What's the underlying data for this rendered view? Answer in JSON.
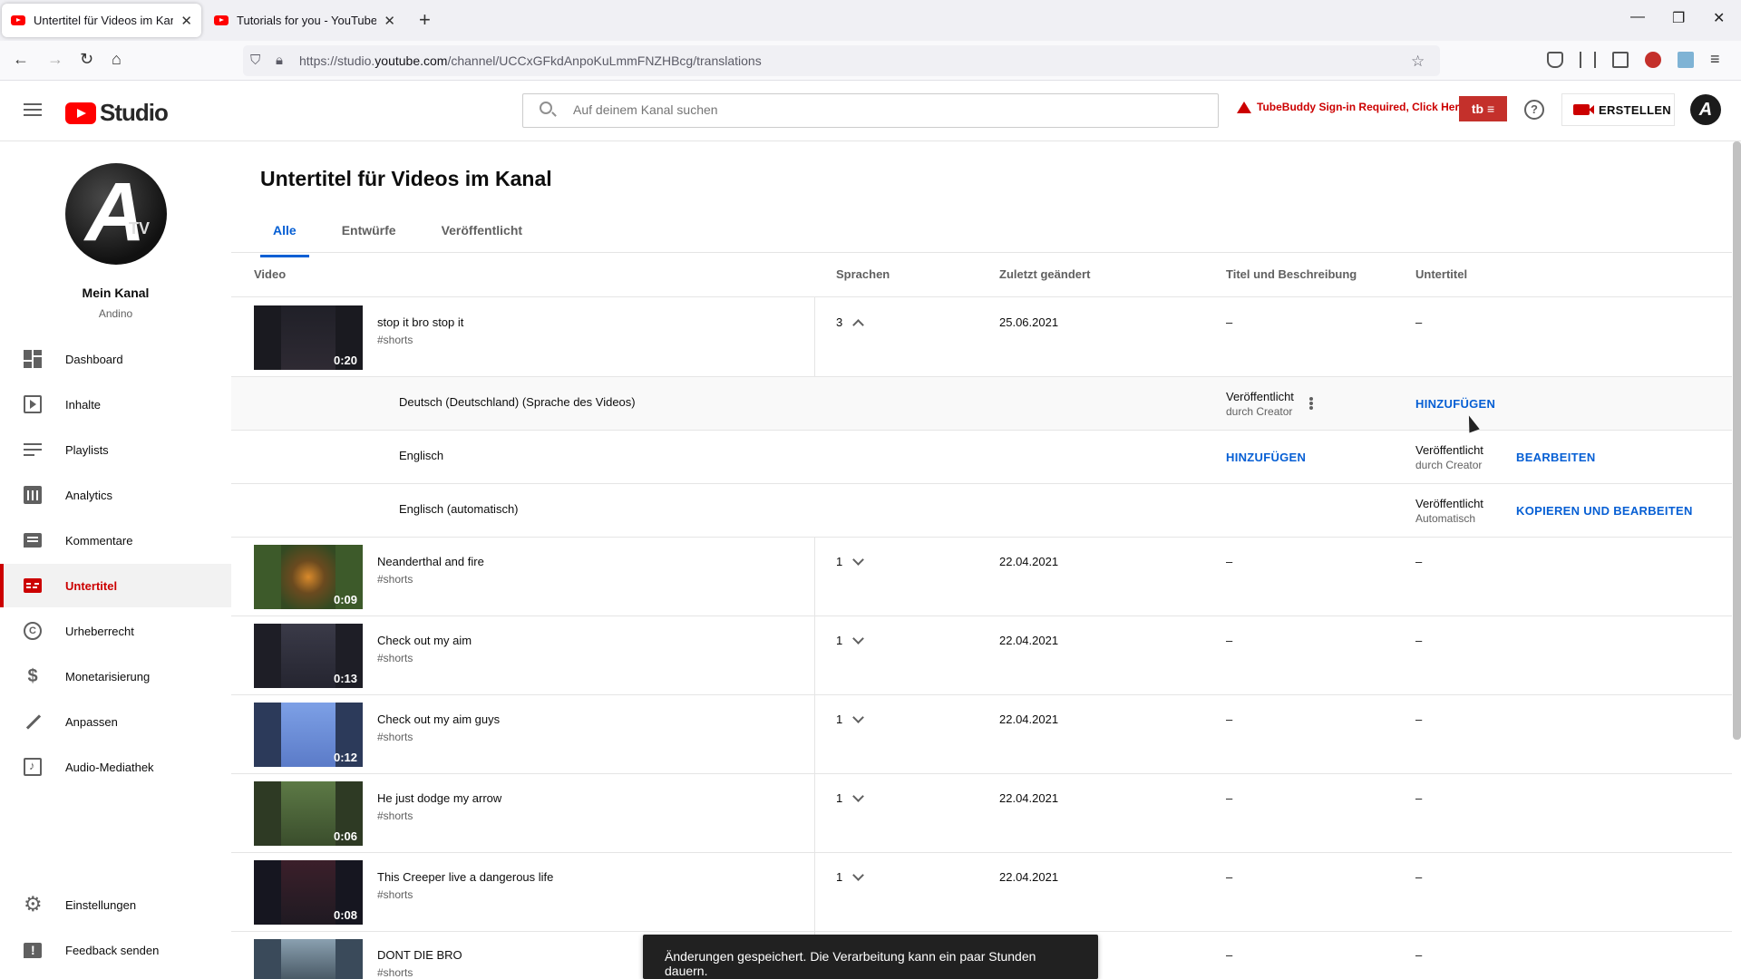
{
  "browser": {
    "tabs": [
      {
        "title": "Untertitel für Videos im Kanal -",
        "close": "✕"
      },
      {
        "title": "Tutorials for you - YouTube",
        "close": "✕"
      }
    ],
    "new_tab": "+",
    "url_prefix": "https://studio.",
    "url_domain": "youtube.com",
    "url_path": "/channel/UCCxGFkdAnpoKuLmmFNZHBcg/translations"
  },
  "header": {
    "logo_text": "Studio",
    "search_placeholder": "Auf deinem Kanal suchen",
    "tubebuddy_text": "TubeBuddy Sign-in Required, Click Here",
    "help": "?",
    "create_label": "ERSTELLEN",
    "avatar_letter": "A"
  },
  "sidebar": {
    "channel_name": "Mein Kanal",
    "channel_handle": "Andino",
    "items": [
      {
        "label": "Dashboard",
        "icon": "dashboard-icon"
      },
      {
        "label": "Inhalte",
        "icon": "content-icon"
      },
      {
        "label": "Playlists",
        "icon": "playlists-icon"
      },
      {
        "label": "Analytics",
        "icon": "analytics-icon"
      },
      {
        "label": "Kommentare",
        "icon": "comments-icon"
      },
      {
        "label": "Untertitel",
        "icon": "subtitles-icon"
      },
      {
        "label": "Urheberrecht",
        "icon": "copyright-icon"
      },
      {
        "label": "Monetarisierung",
        "icon": "monetization-icon"
      },
      {
        "label": "Anpassen",
        "icon": "customization-icon"
      },
      {
        "label": "Audio-Mediathek",
        "icon": "audio-library-icon"
      }
    ],
    "bottom_items": [
      {
        "label": "Einstellungen",
        "icon": "settings-icon"
      },
      {
        "label": "Feedback senden",
        "icon": "feedback-icon"
      }
    ]
  },
  "main": {
    "title": "Untertitel für Videos im Kanal",
    "tabs": [
      "Alle",
      "Entwürfe",
      "Veröffentlicht"
    ],
    "columns": [
      "Video",
      "Sprachen",
      "Zuletzt geändert",
      "Titel und Beschreibung",
      "Untertitel"
    ],
    "videos": [
      {
        "title": "stop it bro stop it",
        "desc": "#shorts",
        "duration": "0:20",
        "languages": "3",
        "date": "25.06.2021",
        "title_desc": "–",
        "subtitles": "–"
      },
      {
        "title": "Neanderthal and fire",
        "desc": "#shorts",
        "duration": "0:09",
        "languages": "1",
        "date": "22.04.2021",
        "title_desc": "–",
        "subtitles": "–"
      },
      {
        "title": "Check out my aim",
        "desc": "#shorts",
        "duration": "0:13",
        "languages": "1",
        "date": "22.04.2021",
        "title_desc": "–",
        "subtitles": "–"
      },
      {
        "title": "Check out my aim guys",
        "desc": "#shorts",
        "duration": "0:12",
        "languages": "1",
        "date": "22.04.2021",
        "title_desc": "–",
        "subtitles": "–"
      },
      {
        "title": "He just dodge my arrow",
        "desc": "#shorts",
        "duration": "0:06",
        "languages": "1",
        "date": "22.04.2021",
        "title_desc": "–",
        "subtitles": "–"
      },
      {
        "title": "This Creeper live a dangerous life",
        "desc": "#shorts",
        "duration": "0:08",
        "languages": "1",
        "date": "22.04.2021",
        "title_desc": "–",
        "subtitles": "–"
      },
      {
        "title": "DONT DIE BRO",
        "desc": "#shorts",
        "duration": "",
        "languages": "",
        "date": "",
        "title_desc": "–",
        "subtitles": "–"
      }
    ],
    "language_rows": [
      {
        "name": "Deutsch (Deutschland) (Sprache des Videos)",
        "title_status": "Veröffentlicht",
        "title_sub": "durch Creator",
        "subtitle_action": "HINZUFÜGEN"
      },
      {
        "name": "Englisch",
        "title_action": "HINZUFÜGEN",
        "sub_status": "Veröffentlicht",
        "sub_sub": "durch Creator",
        "sub_action": "BEARBEITEN"
      },
      {
        "name": "Englisch (automatisch)",
        "sub_status": "Veröffentlicht",
        "sub_sub": "Automatisch",
        "sub_action": "KOPIEREN UND BEARBEITEN"
      }
    ]
  },
  "toast": "Änderungen gespeichert. Die Verarbeitung kann ein paar Stunden dauern.",
  "colors": {
    "accent": "#065fd4",
    "brand_red": "#ff0000",
    "active_red": "#cc0000"
  }
}
